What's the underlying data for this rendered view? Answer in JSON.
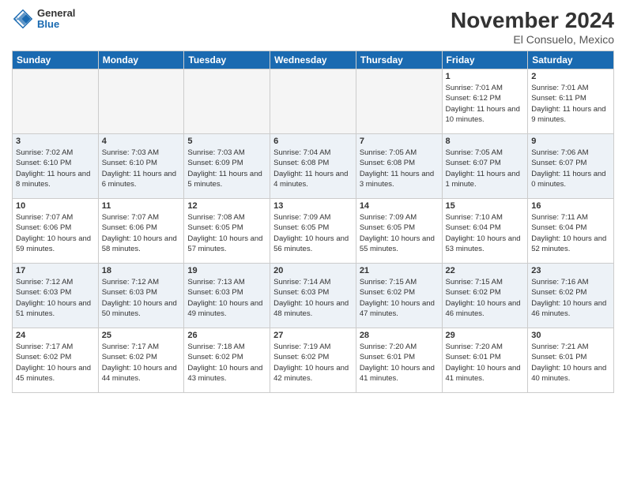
{
  "header": {
    "logo_general": "General",
    "logo_blue": "Blue",
    "month_title": "November 2024",
    "location": "El Consuelo, Mexico"
  },
  "days_of_week": [
    "Sunday",
    "Monday",
    "Tuesday",
    "Wednesday",
    "Thursday",
    "Friday",
    "Saturday"
  ],
  "weeks": [
    [
      {
        "day": "",
        "info": ""
      },
      {
        "day": "",
        "info": ""
      },
      {
        "day": "",
        "info": ""
      },
      {
        "day": "",
        "info": ""
      },
      {
        "day": "",
        "info": ""
      },
      {
        "day": "1",
        "info": "Sunrise: 7:01 AM\nSunset: 6:12 PM\nDaylight: 11 hours and 10 minutes."
      },
      {
        "day": "2",
        "info": "Sunrise: 7:01 AM\nSunset: 6:11 PM\nDaylight: 11 hours and 9 minutes."
      }
    ],
    [
      {
        "day": "3",
        "info": "Sunrise: 7:02 AM\nSunset: 6:10 PM\nDaylight: 11 hours and 8 minutes."
      },
      {
        "day": "4",
        "info": "Sunrise: 7:03 AM\nSunset: 6:10 PM\nDaylight: 11 hours and 6 minutes."
      },
      {
        "day": "5",
        "info": "Sunrise: 7:03 AM\nSunset: 6:09 PM\nDaylight: 11 hours and 5 minutes."
      },
      {
        "day": "6",
        "info": "Sunrise: 7:04 AM\nSunset: 6:08 PM\nDaylight: 11 hours and 4 minutes."
      },
      {
        "day": "7",
        "info": "Sunrise: 7:05 AM\nSunset: 6:08 PM\nDaylight: 11 hours and 3 minutes."
      },
      {
        "day": "8",
        "info": "Sunrise: 7:05 AM\nSunset: 6:07 PM\nDaylight: 11 hours and 1 minute."
      },
      {
        "day": "9",
        "info": "Sunrise: 7:06 AM\nSunset: 6:07 PM\nDaylight: 11 hours and 0 minutes."
      }
    ],
    [
      {
        "day": "10",
        "info": "Sunrise: 7:07 AM\nSunset: 6:06 PM\nDaylight: 10 hours and 59 minutes."
      },
      {
        "day": "11",
        "info": "Sunrise: 7:07 AM\nSunset: 6:06 PM\nDaylight: 10 hours and 58 minutes."
      },
      {
        "day": "12",
        "info": "Sunrise: 7:08 AM\nSunset: 6:05 PM\nDaylight: 10 hours and 57 minutes."
      },
      {
        "day": "13",
        "info": "Sunrise: 7:09 AM\nSunset: 6:05 PM\nDaylight: 10 hours and 56 minutes."
      },
      {
        "day": "14",
        "info": "Sunrise: 7:09 AM\nSunset: 6:05 PM\nDaylight: 10 hours and 55 minutes."
      },
      {
        "day": "15",
        "info": "Sunrise: 7:10 AM\nSunset: 6:04 PM\nDaylight: 10 hours and 53 minutes."
      },
      {
        "day": "16",
        "info": "Sunrise: 7:11 AM\nSunset: 6:04 PM\nDaylight: 10 hours and 52 minutes."
      }
    ],
    [
      {
        "day": "17",
        "info": "Sunrise: 7:12 AM\nSunset: 6:03 PM\nDaylight: 10 hours and 51 minutes."
      },
      {
        "day": "18",
        "info": "Sunrise: 7:12 AM\nSunset: 6:03 PM\nDaylight: 10 hours and 50 minutes."
      },
      {
        "day": "19",
        "info": "Sunrise: 7:13 AM\nSunset: 6:03 PM\nDaylight: 10 hours and 49 minutes."
      },
      {
        "day": "20",
        "info": "Sunrise: 7:14 AM\nSunset: 6:03 PM\nDaylight: 10 hours and 48 minutes."
      },
      {
        "day": "21",
        "info": "Sunrise: 7:15 AM\nSunset: 6:02 PM\nDaylight: 10 hours and 47 minutes."
      },
      {
        "day": "22",
        "info": "Sunrise: 7:15 AM\nSunset: 6:02 PM\nDaylight: 10 hours and 46 minutes."
      },
      {
        "day": "23",
        "info": "Sunrise: 7:16 AM\nSunset: 6:02 PM\nDaylight: 10 hours and 46 minutes."
      }
    ],
    [
      {
        "day": "24",
        "info": "Sunrise: 7:17 AM\nSunset: 6:02 PM\nDaylight: 10 hours and 45 minutes."
      },
      {
        "day": "25",
        "info": "Sunrise: 7:17 AM\nSunset: 6:02 PM\nDaylight: 10 hours and 44 minutes."
      },
      {
        "day": "26",
        "info": "Sunrise: 7:18 AM\nSunset: 6:02 PM\nDaylight: 10 hours and 43 minutes."
      },
      {
        "day": "27",
        "info": "Sunrise: 7:19 AM\nSunset: 6:02 PM\nDaylight: 10 hours and 42 minutes."
      },
      {
        "day": "28",
        "info": "Sunrise: 7:20 AM\nSunset: 6:01 PM\nDaylight: 10 hours and 41 minutes."
      },
      {
        "day": "29",
        "info": "Sunrise: 7:20 AM\nSunset: 6:01 PM\nDaylight: 10 hours and 41 minutes."
      },
      {
        "day": "30",
        "info": "Sunrise: 7:21 AM\nSunset: 6:01 PM\nDaylight: 10 hours and 40 minutes."
      }
    ]
  ]
}
